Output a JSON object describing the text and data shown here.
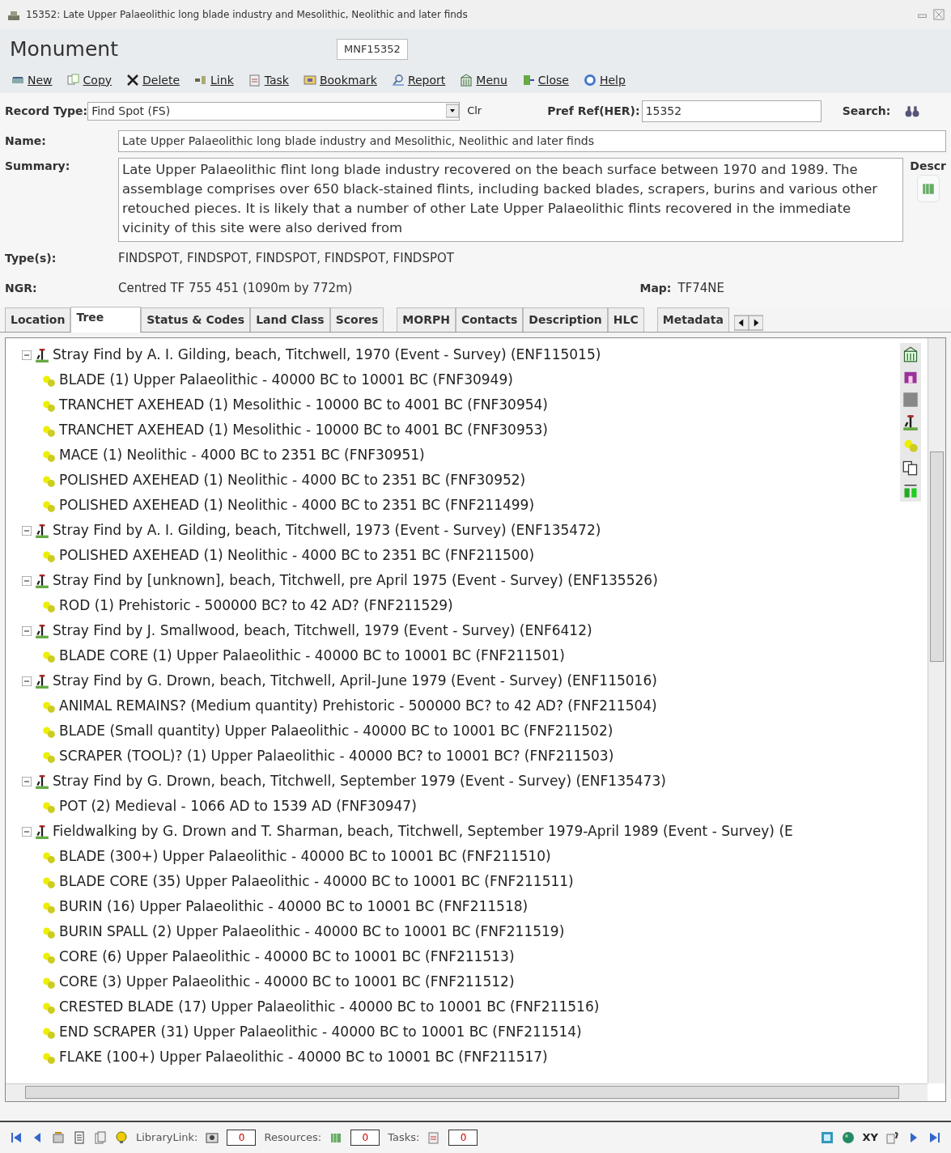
{
  "window": {
    "title": "15352: Late Upper Palaeolithic long blade industry and Mesolithic, Neolithic and later finds"
  },
  "header": {
    "heading": "Monument",
    "ref": "MNF15352"
  },
  "toolbar": [
    {
      "label": "New"
    },
    {
      "label": "Copy"
    },
    {
      "label": "Delete"
    },
    {
      "label": "Link"
    },
    {
      "label": "Task"
    },
    {
      "label": "Bookmark"
    },
    {
      "label": "Report"
    },
    {
      "label": "Menu"
    },
    {
      "label": "Close"
    },
    {
      "label": "Help"
    }
  ],
  "form": {
    "record_type_label": "Record Type:",
    "record_type": "Find Spot (FS)",
    "clear": "Clr",
    "pref_ref_label": "Pref Ref(HER):",
    "pref_ref": "15352",
    "search_label": "Search:",
    "name_label": "Name:",
    "name": "Late Upper Palaeolithic long blade industry and Mesolithic, Neolithic and later finds",
    "summary_label": "Summary:",
    "summary": "Late Upper Palaeolithic flint long blade industry recovered on the beach surface between 1970 and 1989. The assemblage comprises over 650 black-stained flints, including backed blades, scrapers, burins and various other retouched pieces. It is likely that a number of other Late Upper Palaeolithic flints recovered in the immediate vicinity of this site were also derived from",
    "descr_label": "Descr",
    "types_label": "Type(s):",
    "types": "FINDSPOT, FINDSPOT, FINDSPOT, FINDSPOT, FINDSPOT",
    "ngr_label": "NGR:",
    "ngr": "Centred TF 755 451 (1090m by 772m)",
    "map_label": "Map:",
    "map": "TF74NE"
  },
  "tabs": [
    {
      "label": "Location",
      "selected": false
    },
    {
      "label": "Tree",
      "selected": true
    },
    {
      "label": "Status & Codes",
      "selected": false
    },
    {
      "label": "Land Class",
      "selected": false
    },
    {
      "label": "Scores",
      "selected": false
    },
    {
      "label": "MORPH",
      "selected": false
    },
    {
      "label": "Contacts",
      "selected": false
    },
    {
      "label": "Description",
      "selected": false
    },
    {
      "label": "HLC",
      "selected": false
    },
    {
      "label": "Metadata",
      "selected": false
    }
  ],
  "tree": [
    {
      "label": "Stray Find by A. I. Gilding, beach, Titchwell, 1970 (Event - Survey) (ENF115015)",
      "expanded": true,
      "children": [
        {
          "label": "BLADE (1) Upper Palaeolithic - 40000 BC to 10001 BC (FNF30949)"
        },
        {
          "label": "TRANCHET AXEHEAD (1) Mesolithic - 10000 BC to 4001 BC (FNF30954)"
        },
        {
          "label": "TRANCHET AXEHEAD (1) Mesolithic - 10000 BC to 4001 BC (FNF30953)"
        },
        {
          "label": "MACE (1) Neolithic - 4000 BC to 2351 BC (FNF30951)"
        },
        {
          "label": "POLISHED AXEHEAD (1) Neolithic - 4000 BC to 2351 BC (FNF30952)"
        },
        {
          "label": "POLISHED AXEHEAD (1) Neolithic - 4000 BC to 2351 BC (FNF211499)"
        }
      ]
    },
    {
      "label": "Stray Find by A. I. Gilding, beach, Titchwell, 1973 (Event - Survey) (ENF135472)",
      "expanded": true,
      "children": [
        {
          "label": "POLISHED AXEHEAD (1) Neolithic - 4000 BC to 2351 BC (FNF211500)"
        }
      ]
    },
    {
      "label": "Stray Find by [unknown], beach, Titchwell, pre April 1975 (Event - Survey) (ENF135526)",
      "expanded": true,
      "children": [
        {
          "label": "ROD (1) Prehistoric - 500000 BC? to 42 AD? (FNF211529)"
        }
      ]
    },
    {
      "label": "Stray Find by J. Smallwood, beach, Titchwell, 1979 (Event - Survey) (ENF6412)",
      "expanded": true,
      "children": [
        {
          "label": "BLADE CORE (1) Upper Palaeolithic - 40000 BC to 10001 BC (FNF211501)"
        }
      ]
    },
    {
      "label": "Stray Find by G. Drown, beach, Titchwell, April-June 1979 (Event - Survey) (ENF115016)",
      "expanded": true,
      "children": [
        {
          "label": "ANIMAL REMAINS? (Medium quantity) Prehistoric - 500000 BC? to 42 AD? (FNF211504)"
        },
        {
          "label": "BLADE (Small quantity) Upper Palaeolithic - 40000 BC to 10001 BC (FNF211502)"
        },
        {
          "label": "SCRAPER (TOOL)? (1) Upper Palaeolithic - 40000 BC? to 10001 BC? (FNF211503)"
        }
      ]
    },
    {
      "label": "Stray Find by G. Drown, beach, Titchwell, September 1979 (Event - Survey) (ENF135473)",
      "expanded": true,
      "children": [
        {
          "label": "POT (2) Medieval - 1066 AD to 1539 AD (FNF30947)"
        }
      ]
    },
    {
      "label": "Fieldwalking by G. Drown and T. Sharman, beach, Titchwell, September 1979-April 1989 (Event - Survey) (E",
      "expanded": true,
      "children": [
        {
          "label": "BLADE (300+) Upper Palaeolithic - 40000 BC to 10001 BC (FNF211510)"
        },
        {
          "label": "BLADE CORE (35) Upper Palaeolithic - 40000 BC to 10001 BC (FNF211511)"
        },
        {
          "label": "BURIN (16) Upper Palaeolithic - 40000 BC to 10001 BC (FNF211518)"
        },
        {
          "label": "BURIN SPALL (2) Upper Palaeolithic - 40000 BC to 10001 BC (FNF211519)"
        },
        {
          "label": "CORE (6) Upper Palaeolithic - 40000 BC to 10001 BC (FNF211513)"
        },
        {
          "label": "CORE (3) Upper Palaeolithic - 40000 BC to 10001 BC (FNF211512)"
        },
        {
          "label": "CRESTED BLADE (17) Upper Palaeolithic - 40000 BC to 10001 BC (FNF211516)"
        },
        {
          "label": "END SCRAPER (31) Upper Palaeolithic - 40000 BC to 10001 BC (FNF211514)"
        },
        {
          "label": "FLAKE (100+) Upper Palaeolithic - 40000 BC to 10001 BC (FNF211517)"
        }
      ]
    }
  ],
  "status_bar": {
    "library_label": "LibraryLink:",
    "library_count": "0",
    "resources_label": "Resources:",
    "resources_count": "0",
    "tasks_label": "Tasks:",
    "tasks_count": "0",
    "xy": "XY"
  }
}
